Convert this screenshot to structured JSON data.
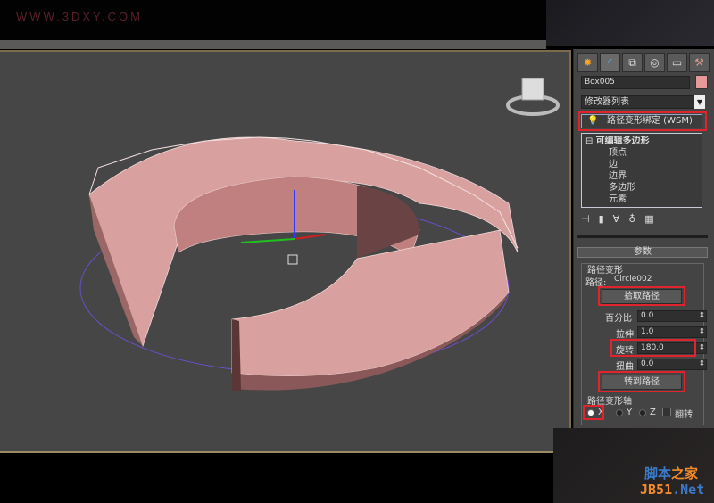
{
  "watermark": "WWW.3DXY.COM",
  "site_logo": {
    "line1a": "脚本",
    "line1b": "之家",
    "line2a": "JB51",
    "line2b": ".Net"
  },
  "panel": {
    "tabs": [
      "create-icon",
      "modify-icon",
      "hierarchy-icon",
      "motion-icon",
      "display-icon",
      "utilities-icon"
    ],
    "object_name": "Box005",
    "object_color": "#e59a9a",
    "modifier_list": "修改器列表",
    "modifier": "路径变形绑定 (WSM)",
    "stack": {
      "base": "可编辑多边形",
      "subs": [
        "顶点",
        "边",
        "边界",
        "多边形",
        "元素"
      ]
    },
    "rollout_title": "参数",
    "group_title": "路径变形",
    "path_label": "路径:",
    "path_value": "Circle002",
    "pick_path": "拾取路径",
    "fields": [
      {
        "label": "百分比",
        "value": "0.0"
      },
      {
        "label": "拉伸",
        "value": "1.0"
      },
      {
        "label": "旋转",
        "value": "180.0"
      },
      {
        "label": "扭曲",
        "value": "0.0"
      }
    ],
    "move_to_path": "转到路径",
    "axis_title": "路径变形轴",
    "axes": [
      "X",
      "Y",
      "Z"
    ],
    "selected_axis": "X",
    "flip": "翻转"
  },
  "colors": {
    "highlight": "#e0242e",
    "mesh": "#d9a0a0"
  }
}
